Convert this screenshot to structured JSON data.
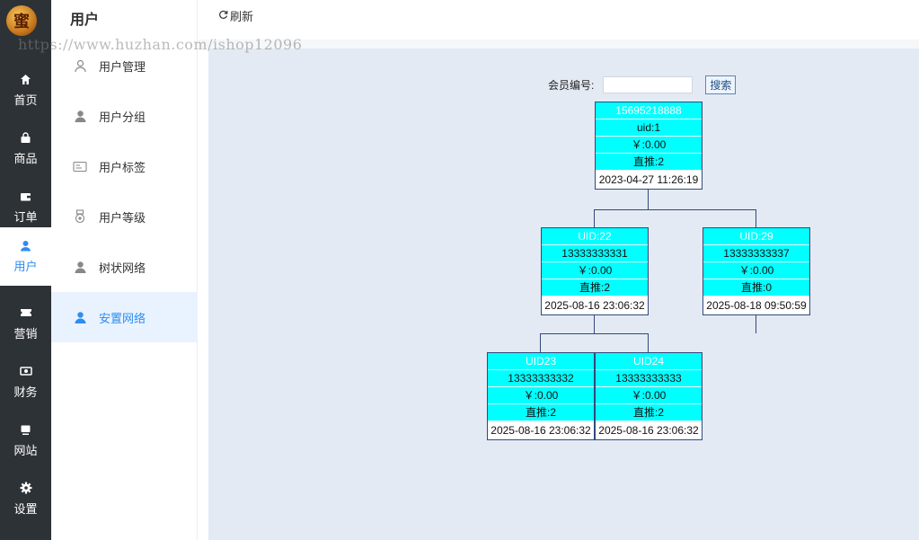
{
  "rail": {
    "logo_text": "蜜",
    "items": [
      {
        "label": "首页",
        "icon": "home-icon"
      },
      {
        "label": "商品",
        "icon": "bag-icon"
      },
      {
        "label": "订单",
        "icon": "wallet-icon"
      },
      {
        "label": "用户",
        "icon": "user-icon"
      },
      {
        "label": "营销",
        "icon": "ticket-icon"
      },
      {
        "label": "财务",
        "icon": "finance-icon"
      },
      {
        "label": "网站",
        "icon": "monitor-icon"
      },
      {
        "label": "设置",
        "icon": "gear-icon"
      }
    ],
    "active": "用户"
  },
  "subnav": {
    "title": "用户",
    "items": [
      {
        "label": "用户管理",
        "icon": "user-outline-icon"
      },
      {
        "label": "用户分组",
        "icon": "user-group-icon"
      },
      {
        "label": "用户标签",
        "icon": "id-card-icon"
      },
      {
        "label": "用户等级",
        "icon": "medal-icon"
      },
      {
        "label": "树状网络",
        "icon": "user-tree-icon"
      },
      {
        "label": "安置网络",
        "icon": "user-place-icon"
      }
    ],
    "active": "安置网络"
  },
  "topbar": {
    "refresh_label": "刷新",
    "refresh_icon": "refresh-icon"
  },
  "watermark": "https://www.huzhan.com/ishop12096",
  "search": {
    "label": "会员编号:",
    "value": "",
    "placeholder": "",
    "button": "搜索"
  },
  "accent_colors": {
    "node_fill": "#00ffff",
    "node_border": "#2e4a7a",
    "active_blue": "#2f8cf0"
  },
  "tree": {
    "root": {
      "head": "15695218888",
      "uid": "uid:1",
      "amount": "￥:0.00",
      "direct": "直推:2",
      "date": "2023-04-27 11:26:19"
    },
    "level2": [
      {
        "head": "UID:22",
        "phone": "13333333331",
        "amount": "￥:0.00",
        "direct": "直推:2",
        "date": "2025-08-16 23:06:32"
      },
      {
        "head": "UID:29",
        "phone": "13333333337",
        "amount": "￥:0.00",
        "direct": "直推:0",
        "date": "2025-08-18 09:50:59"
      }
    ],
    "level3": [
      {
        "head": "UID23",
        "phone": "13333333332",
        "amount": "￥:0.00",
        "direct": "直推:2",
        "date": "2025-08-16 23:06:32"
      },
      {
        "head": "UID24",
        "phone": "13333333333",
        "amount": "￥:0.00",
        "direct": "直推:2",
        "date": "2025-08-16 23:06:32"
      }
    ]
  }
}
